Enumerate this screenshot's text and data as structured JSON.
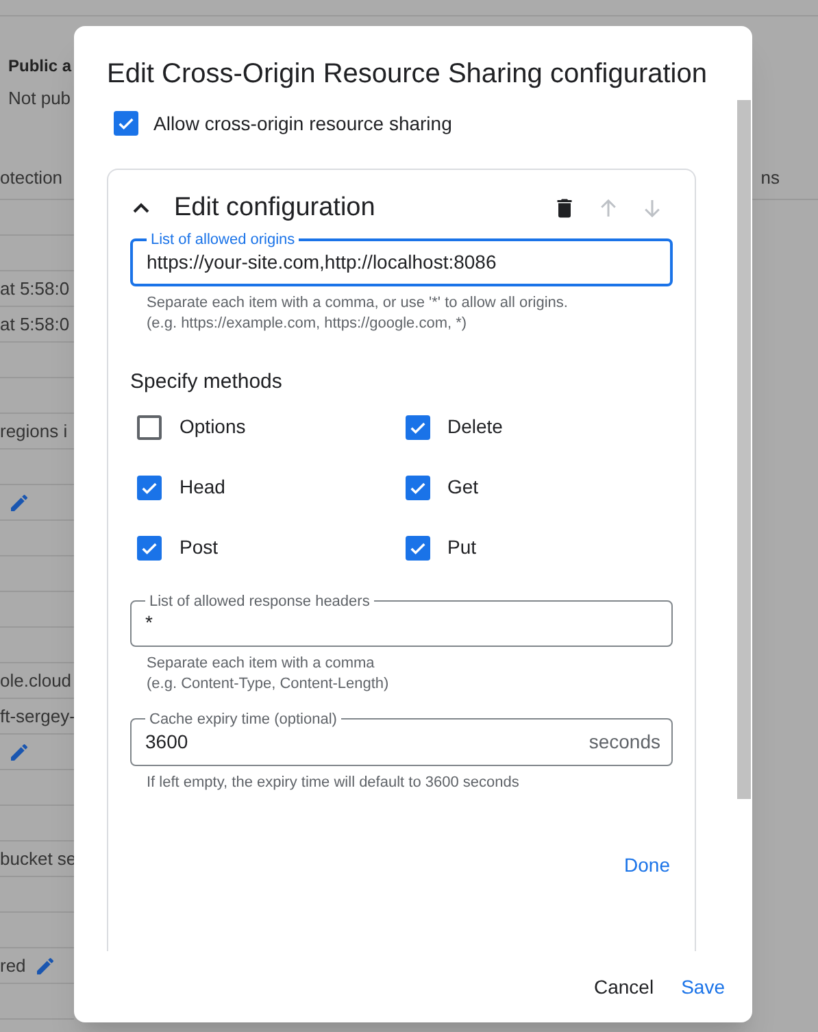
{
  "background": {
    "header_title": "Public a",
    "header_subtitle": "Not pub",
    "column_left": "otection",
    "column_right": "ns",
    "rows": [
      {
        "kind": "blank"
      },
      {
        "kind": "blank"
      },
      {
        "kind": "text",
        "text": "at 5:58:0"
      },
      {
        "kind": "text",
        "text": "at 5:58:0"
      },
      {
        "kind": "blank"
      },
      {
        "kind": "blank"
      },
      {
        "kind": "text",
        "text": "regions i"
      },
      {
        "kind": "blank"
      },
      {
        "kind": "edit"
      },
      {
        "kind": "blank"
      },
      {
        "kind": "blank"
      },
      {
        "kind": "blank"
      },
      {
        "kind": "blank"
      },
      {
        "kind": "text",
        "text": "ole.cloud"
      },
      {
        "kind": "text",
        "text": "ft-sergey-"
      },
      {
        "kind": "edit"
      },
      {
        "kind": "blank"
      },
      {
        "kind": "blank"
      },
      {
        "kind": "text",
        "text": "bucket se"
      },
      {
        "kind": "blank"
      },
      {
        "kind": "blank"
      },
      {
        "kind": "text_edit",
        "text": "red"
      },
      {
        "kind": "blank"
      }
    ]
  },
  "dialog": {
    "title": "Edit Cross-Origin Resource Sharing configuration",
    "allow": {
      "label": "Allow cross-origin resource sharing",
      "checked": true
    },
    "card": {
      "title": "Edit configuration",
      "expanded": true,
      "origins": {
        "label": "List of allowed origins",
        "value": "https://your-site.com,http://localhost:8086",
        "focused": true,
        "help": [
          "Separate each item with a comma, or use '*' to allow all origins.",
          "(e.g. https://example.com, https://google.com, *)"
        ]
      },
      "methods_title": "Specify methods",
      "methods": [
        {
          "label": "Options",
          "checked": false
        },
        {
          "label": "Delete",
          "checked": true
        },
        {
          "label": "Head",
          "checked": true
        },
        {
          "label": "Get",
          "checked": true
        },
        {
          "label": "Post",
          "checked": true
        },
        {
          "label": "Put",
          "checked": true
        }
      ],
      "headers": {
        "label": "List of allowed response headers",
        "value": "*",
        "focused": false,
        "help": [
          "Separate each item with a comma",
          "(e.g. Content-Type, Content-Length)"
        ]
      },
      "cache": {
        "label": "Cache expiry time (optional)",
        "value": "3600",
        "suffix": "seconds",
        "focused": false,
        "help": [
          "If left empty, the expiry time will default to 3600 seconds"
        ]
      },
      "done": "Done"
    },
    "buttons": {
      "cancel": "Cancel",
      "save": "Save"
    }
  }
}
